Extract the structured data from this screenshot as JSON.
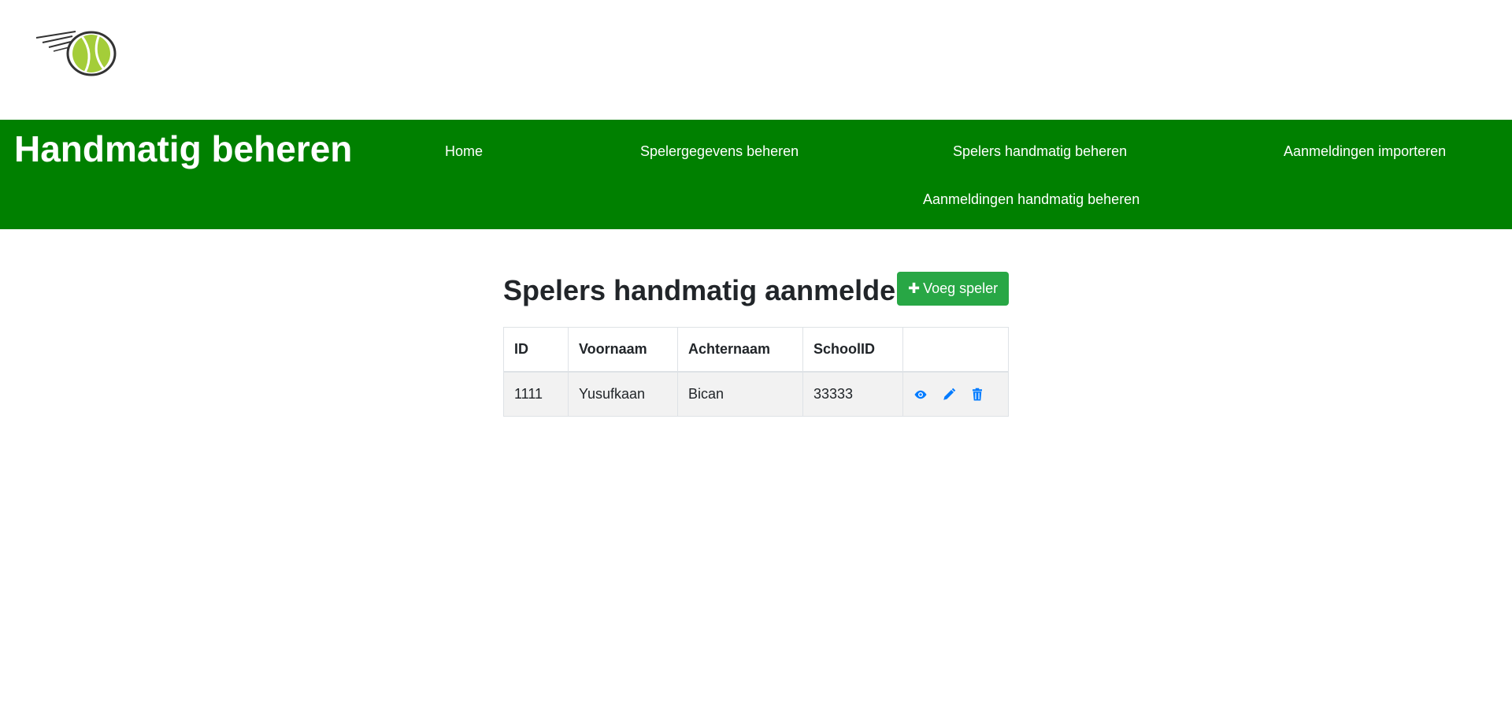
{
  "header": {
    "logo_icon": "tennis-ball-logo",
    "title": "Handmatig beheren"
  },
  "nav": {
    "items": [
      {
        "label": "Home"
      },
      {
        "label": "Spelergegevens beheren"
      },
      {
        "label": "Spelers handmatig beheren"
      },
      {
        "label": "Aanmeldingen importeren"
      },
      {
        "label": "Aanmeldingen handmatig beheren"
      }
    ]
  },
  "main": {
    "title": "Spelers handmatig aanmelden",
    "add_button_label": "Voeg speler",
    "add_button_icon": "plus-icon",
    "table": {
      "columns": [
        "ID",
        "Voornaam",
        "Achternaam",
        "SchoolID",
        ""
      ],
      "rows": [
        {
          "id": "1111",
          "voornaam": "Yusufkaan",
          "achternaam": "Bican",
          "schoolid": "33333",
          "actions": [
            "eye-icon",
            "pencil-icon",
            "trash-icon"
          ]
        }
      ]
    }
  },
  "colors": {
    "navbar": "#008000",
    "add_button": "#28a745",
    "action_icons": "#007bff",
    "row_background": "#f2f2f2"
  }
}
